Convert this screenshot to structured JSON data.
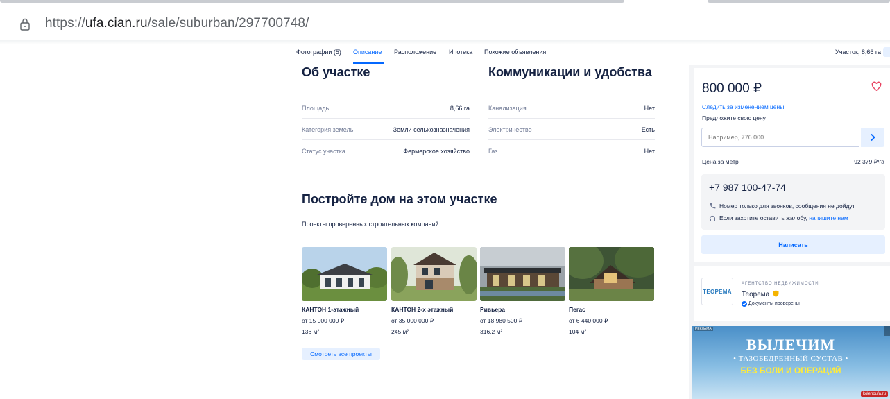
{
  "browser": {
    "url_prefix": "https://",
    "url_host": "ufa.cian.ru",
    "url_path": "/sale/suburban/297700748/"
  },
  "nav": {
    "items": [
      {
        "label": "Фотографии (5)",
        "active": false
      },
      {
        "label": "Описание",
        "active": true
      },
      {
        "label": "Расположение",
        "active": false
      },
      {
        "label": "Ипотека",
        "active": false
      },
      {
        "label": "Похожие объявления",
        "active": false
      }
    ],
    "right_label": "Участок, 8,66 га"
  },
  "about": {
    "title": "Об участке",
    "rows": [
      {
        "label": "Площадь",
        "value": "8,66 га"
      },
      {
        "label": "Категория земель",
        "value": "Земли сельхозназначения"
      },
      {
        "label": "Статус участка",
        "value": "Фермерское хозяйство"
      }
    ]
  },
  "utilities": {
    "title": "Коммуникации и удобства",
    "rows": [
      {
        "label": "Канализация",
        "value": "Нет"
      },
      {
        "label": "Электричество",
        "value": "Есть"
      },
      {
        "label": "Газ",
        "value": "Нет"
      }
    ]
  },
  "build": {
    "title": "Постройте дом на этом участке",
    "subtitle": "Проекты проверенных строительных компаний",
    "projects": [
      {
        "name": "КАНТОН 1-этажный",
        "price": "от 15 000 000 ₽",
        "area": "136 м²"
      },
      {
        "name": "КАНТОН 2-х этажный",
        "price": "от 35 000 000 ₽",
        "area": "245 м²"
      },
      {
        "name": "Ривьера",
        "price": "от 18 980 500 ₽",
        "area": "316.2 м²"
      },
      {
        "name": "Пегас",
        "price": "от 6 440 000 ₽",
        "area": "104 м²"
      }
    ],
    "all_button": "Смотреть все проекты"
  },
  "offer": {
    "price": "800 000 ₽",
    "follow_link": "Следить за изменением цены",
    "propose_label": "Предложите свою цену",
    "input_placeholder": "Например, 776 000",
    "price_per_label": "Цена за метр",
    "price_per_value": "92 379 ₽/га",
    "phone": "+7 987 100-47-74",
    "calls_only": "Номер только для звонков, сообщения не дойдут",
    "complaint_text": "Если захотите оставить жалобу,",
    "complaint_link": "напишите нам",
    "write_button": "Написать"
  },
  "agency": {
    "tag": "Агентство недвижимости",
    "name": "Теорема",
    "logo_text": "ТЕОРЕМА",
    "verified": "Документы проверены"
  },
  "ad": {
    "label": "РЕКЛАМА",
    "headline": "ВЫЛЕЧИМ",
    "line2": "• ТАЗОБЕДРЕННЫЙ СУСТАВ •",
    "line3": "БЕЗ БОЛИ И ОПЕРАЦИЙ",
    "site": "kolenoufa.ru"
  },
  "colors": {
    "accent": "#0468ff",
    "text": "#152242",
    "muted": "#707a95"
  }
}
